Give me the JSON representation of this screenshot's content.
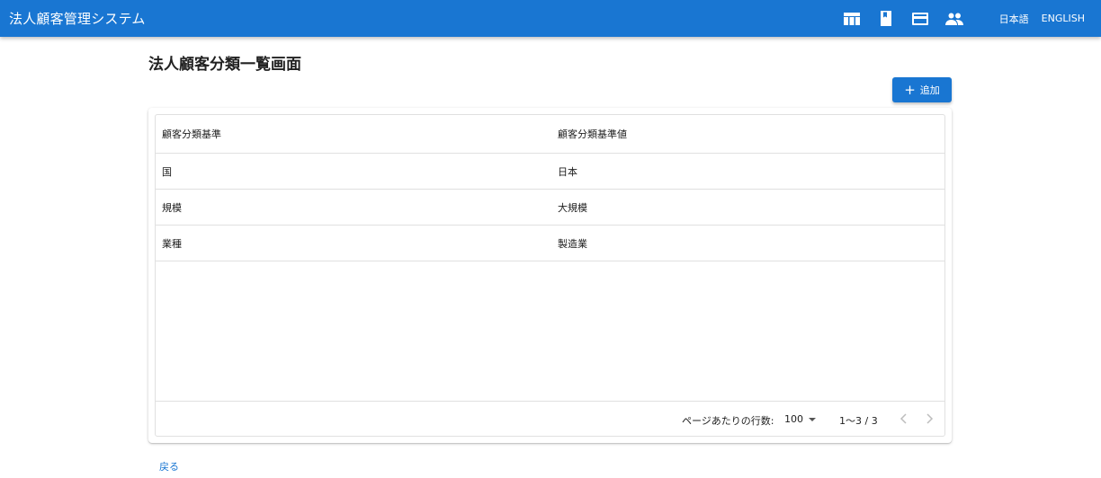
{
  "appbar": {
    "title": "法人顧客管理システム",
    "icons": [
      "table-icon",
      "book-icon",
      "card-icon",
      "people-icon"
    ],
    "lang_ja": "日本語",
    "lang_en": "ENGLISH",
    "color": "#1976d2"
  },
  "page": {
    "title": "法人顧客分類一覧画面",
    "add_button": "追加",
    "back_link": "戻る"
  },
  "table": {
    "columns": [
      "顧客分類基準",
      "顧客分類基準値"
    ],
    "rows": [
      [
        "国",
        "日本"
      ],
      [
        "規模",
        "大規模"
      ],
      [
        "業種",
        "製造業"
      ]
    ]
  },
  "pagination": {
    "rows_per_page_label": "ページあたりの行数:",
    "rows_per_page": "100",
    "range": "1〜3 / 3"
  }
}
